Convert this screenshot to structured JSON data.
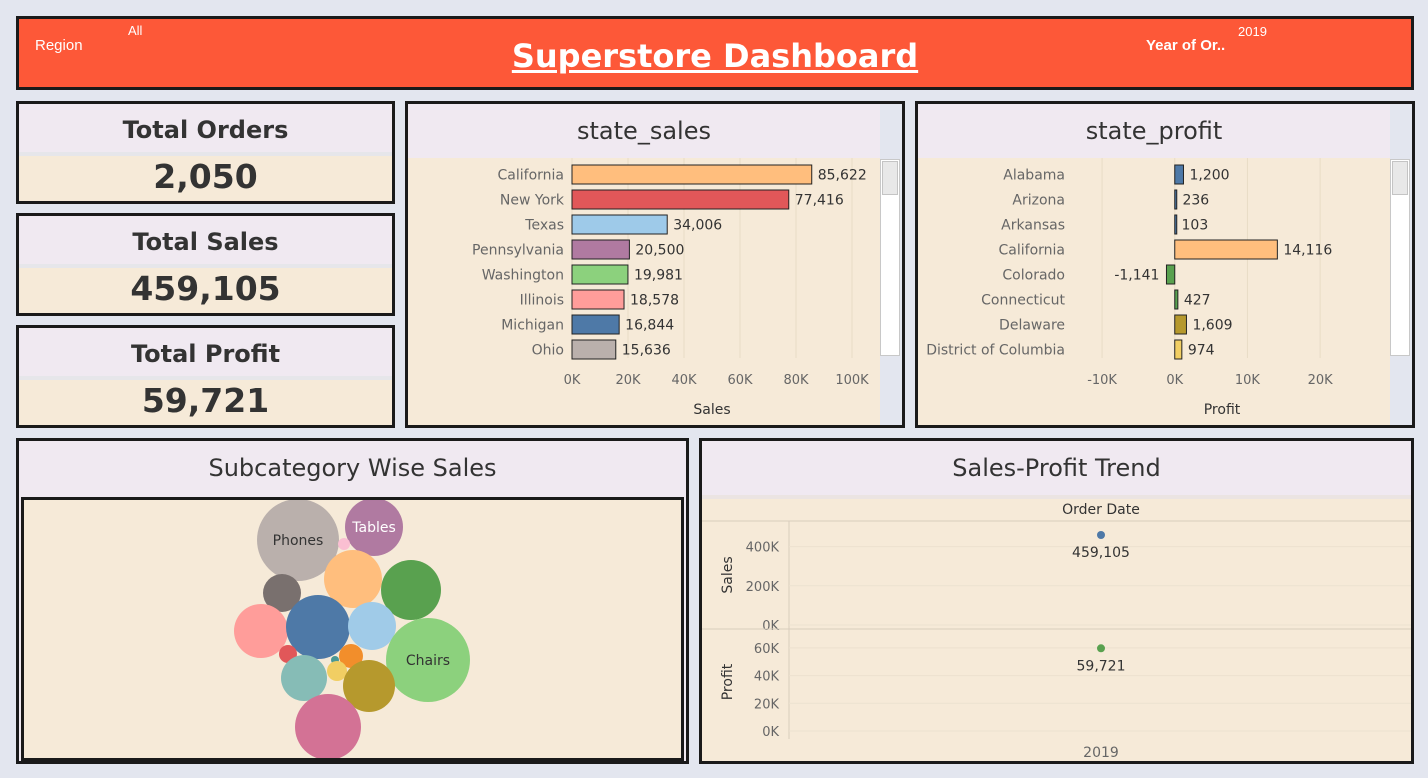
{
  "header": {
    "title": "Superstore Dashboard",
    "region_label": "Region",
    "region_value": "All",
    "year_label": "Year of Or..",
    "year_value": "2019",
    "bg_color": "#fd5838"
  },
  "kpis": [
    {
      "label": "Total Orders",
      "value": "2,050"
    },
    {
      "label": "Total Sales",
      "value": "459,105"
    },
    {
      "label": "Total Profit",
      "value": "59,721"
    }
  ],
  "state_sales": {
    "title": "state_sales",
    "chart_data": {
      "type": "bar",
      "orientation": "horizontal",
      "categories": [
        "California",
        "New York",
        "Texas",
        "Pennsylvania",
        "Washington",
        "Illinois",
        "Michigan",
        "Ohio"
      ],
      "values": [
        85622,
        77416,
        34006,
        20500,
        19981,
        18578,
        16844,
        15636
      ],
      "value_labels": [
        "85,622",
        "77,416",
        "34,006",
        "20,500",
        "19,981",
        "18,578",
        "16,844",
        "15,636"
      ],
      "colors": [
        "#ffbe7d",
        "#e15759",
        "#9ecae9",
        "#b07aa1",
        "#8cd17d",
        "#ff9d9a",
        "#4e79a7",
        "#bab0ac"
      ],
      "xlabel": "Sales",
      "xlim": [
        0,
        100000
      ],
      "ticks": [
        "0K",
        "20K",
        "40K",
        "60K",
        "80K",
        "100K"
      ],
      "tick_values": [
        0,
        20000,
        40000,
        60000,
        80000,
        100000
      ]
    }
  },
  "state_profit": {
    "title": "state_profit",
    "chart_data": {
      "type": "bar",
      "orientation": "horizontal",
      "categories": [
        "Alabama",
        "Arizona",
        "Arkansas",
        "California",
        "Colorado",
        "Connecticut",
        "Delaware",
        "District of Columbia"
      ],
      "values": [
        1200,
        236,
        103,
        14116,
        -1141,
        427,
        1609,
        974
      ],
      "value_labels": [
        "1,200",
        "236",
        "103",
        "14,116",
        "-1,141",
        "427",
        "1,609",
        "974"
      ],
      "colors": [
        "#4e79a7",
        "#4e79a7",
        "#4e79a7",
        "#ffbe7d",
        "#59a14f",
        "#59a14f",
        "#b6992d",
        "#f1ce63"
      ],
      "xlabel": "Profit",
      "xlim": [
        -14000,
        27000
      ],
      "ticks": [
        "-10K",
        "0K",
        "10K",
        "20K"
      ],
      "tick_values": [
        -10000,
        0,
        10000,
        20000
      ]
    }
  },
  "subcategory": {
    "title": "Subcategory Wise Sales",
    "chart_data": {
      "type": "bubble",
      "bubbles": [
        {
          "label": "Phones",
          "color": "#bab0ac",
          "size": 41
        },
        {
          "label": "Tables",
          "color": "#b07aa1",
          "size": 29
        },
        {
          "label": "",
          "color": "#ffbe7d",
          "size": 29
        },
        {
          "label": "",
          "color": "#59a14f",
          "size": 30
        },
        {
          "label": "",
          "color": "#79706e",
          "size": 19
        },
        {
          "label": "",
          "color": "#ff9d9a",
          "size": 27
        },
        {
          "label": "",
          "color": "#4e79a7",
          "size": 32
        },
        {
          "label": "",
          "color": "#a0cbe8",
          "size": 24
        },
        {
          "label": "Chairs",
          "color": "#8cd17d",
          "size": 42
        },
        {
          "label": "",
          "color": "#e15759",
          "size": 9
        },
        {
          "label": "",
          "color": "#f28e2b",
          "size": 12
        },
        {
          "label": "",
          "color": "#499894",
          "size": 4
        },
        {
          "label": "",
          "color": "#86bcb6",
          "size": 23
        },
        {
          "label": "",
          "color": "#f1ce63",
          "size": 10
        },
        {
          "label": "",
          "color": "#b6992d",
          "size": 26
        },
        {
          "label": "",
          "color": "#d37295",
          "size": 33
        },
        {
          "label": "",
          "color": "#fabfd2",
          "size": 6
        }
      ]
    }
  },
  "trend": {
    "title": "Sales-Profit Trend",
    "chart_data": {
      "type": "scatter",
      "column_header": "Order Date",
      "x_category": "2019",
      "series": [
        {
          "name": "Sales",
          "values": [
            459105
          ],
          "value_label": "459,105",
          "color": "#4e79a7",
          "ticks": [
            "400K",
            "200K",
            "0K"
          ],
          "tick_values": [
            400000,
            200000,
            0
          ],
          "ylim": [
            0,
            500000
          ]
        },
        {
          "name": "Profit",
          "values": [
            59721
          ],
          "value_label": "59,721",
          "color": "#59a14f",
          "ticks": [
            "60K",
            "40K",
            "20K",
            "0K"
          ],
          "tick_values": [
            60000,
            40000,
            20000,
            0
          ],
          "ylim": [
            0,
            65000
          ]
        }
      ]
    }
  }
}
